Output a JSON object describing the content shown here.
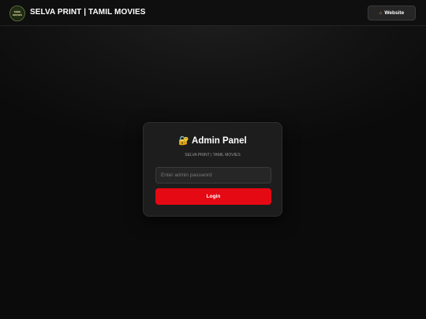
{
  "header": {
    "logo_text": "TAMIL MOVIES",
    "site_title": "SELVA PRINT | TAMIL MOVIES",
    "website_button": {
      "icon": "home-icon",
      "label": "Website"
    }
  },
  "login_card": {
    "icon": "lock-icon",
    "title": "Admin Panel",
    "subtitle": "SELVA PRINT | TAMIL MOVIES",
    "password_field": {
      "value": "",
      "placeholder": "Enter admin password"
    },
    "login_button": {
      "label": "Login"
    }
  },
  "colors": {
    "background": "#0b0b0b",
    "card": "#1d1d1d",
    "accent": "#e50914",
    "button_dark": "#262626"
  }
}
